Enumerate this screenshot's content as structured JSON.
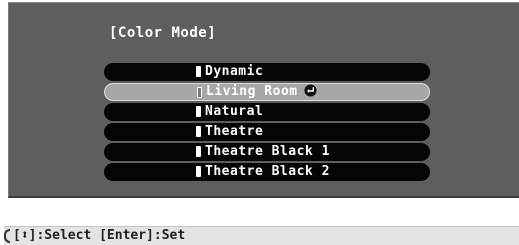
{
  "menu": {
    "title": "[Color Mode]",
    "options": [
      {
        "label": "Dynamic",
        "selected": false
      },
      {
        "label": "Living Room",
        "selected": true
      },
      {
        "label": "Natural",
        "selected": false
      },
      {
        "label": "Theatre",
        "selected": false
      },
      {
        "label": "Theatre Black 1",
        "selected": false
      },
      {
        "label": "Theatre Black 2",
        "selected": false
      }
    ],
    "current_indicator_icon": "enter-return-icon"
  },
  "footer": {
    "hint": "[⬍]:Select [Enter]:Set"
  }
}
